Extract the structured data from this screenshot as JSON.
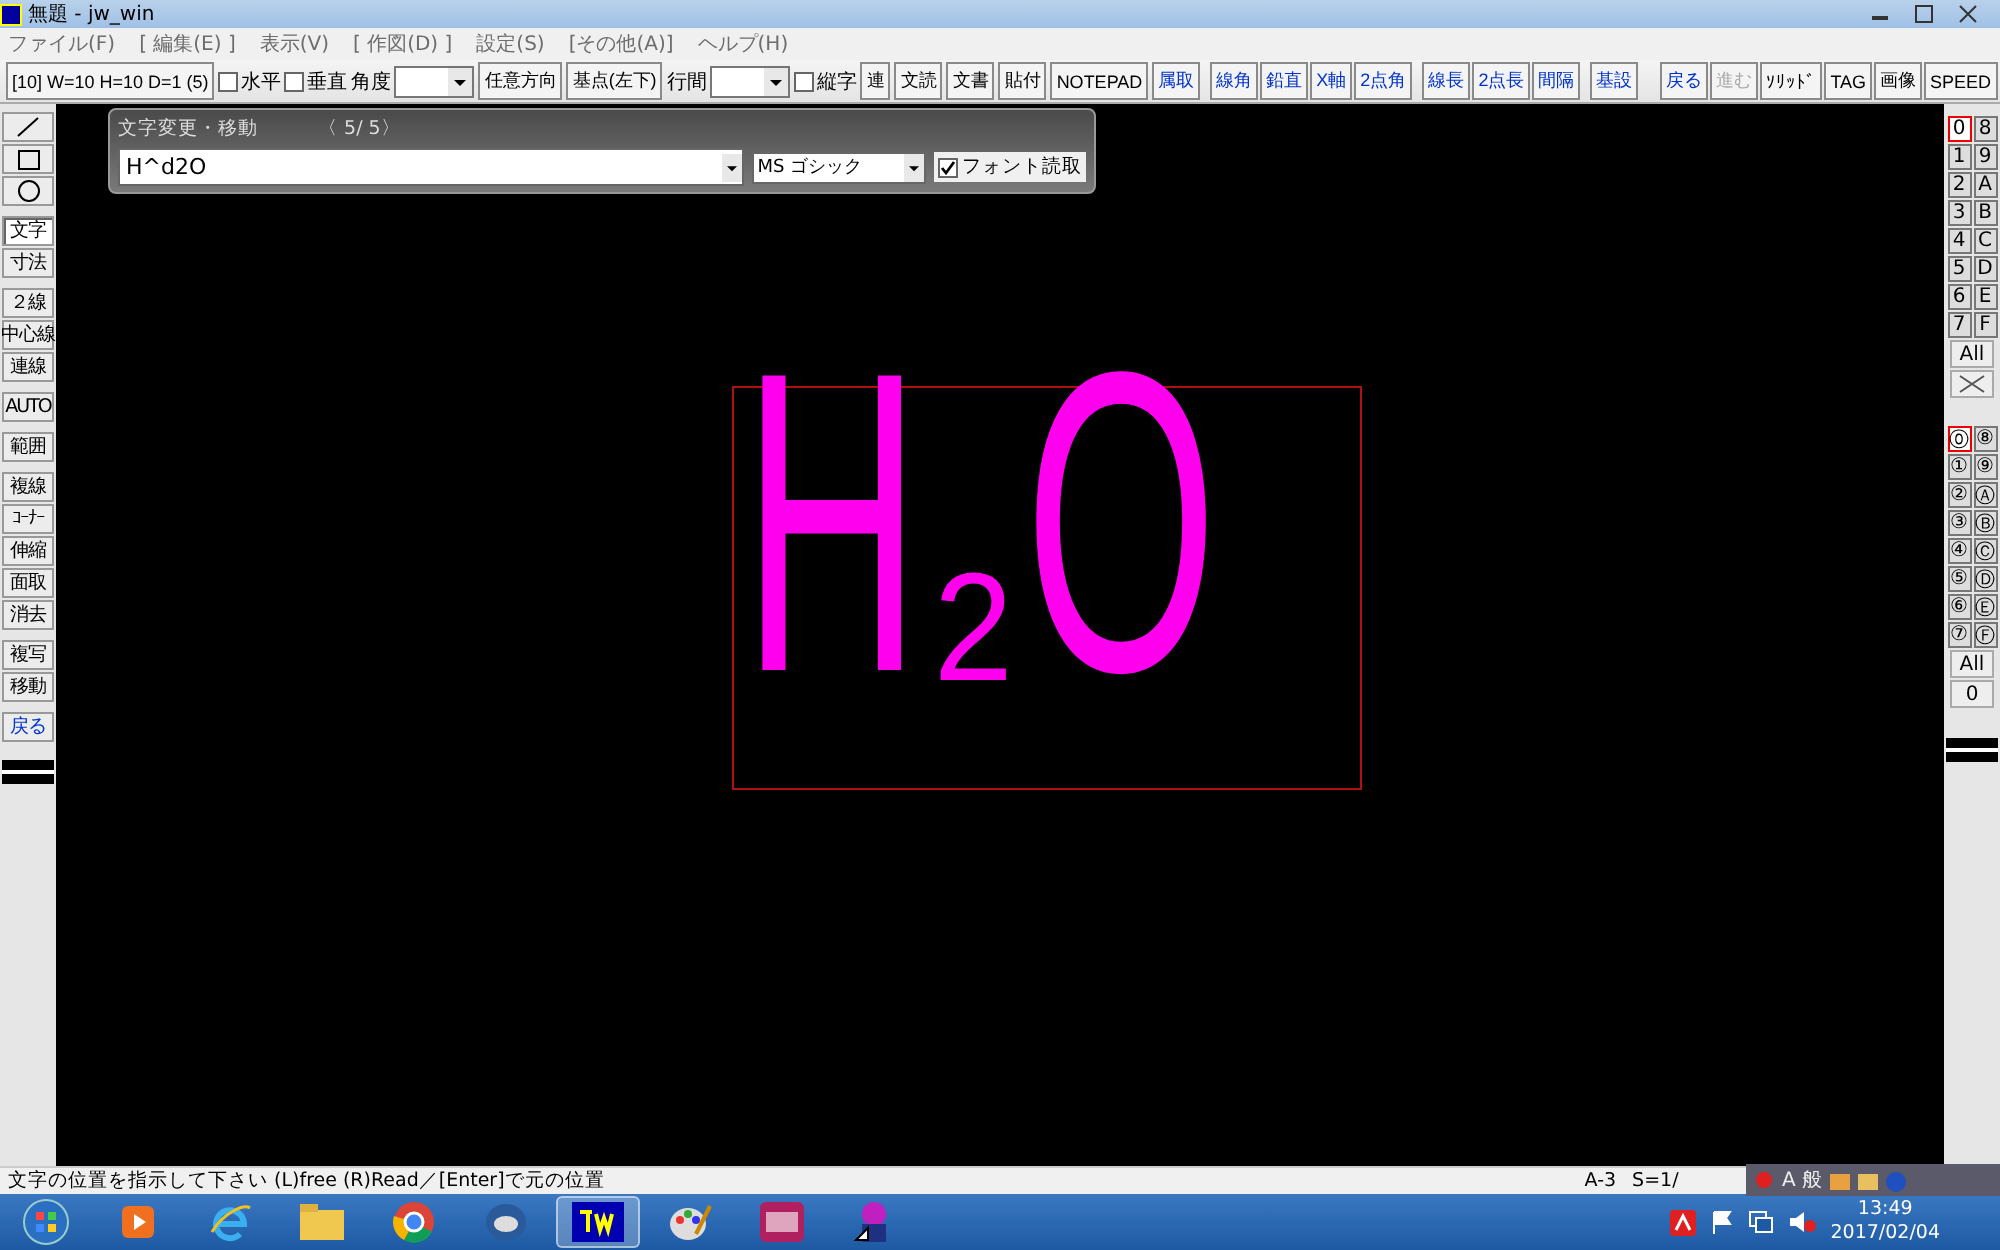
{
  "window": {
    "title": "無題 - jw_win"
  },
  "menu": [
    "ファイル(F)",
    "[ 編集(E) ]",
    "表示(V)",
    "[ 作図(D) ]",
    "設定(S)",
    "[その他(A)]",
    "ヘルプ(H)"
  ],
  "toolbar": {
    "size_button": "[10]  W=10 H=10 D=1 (5)",
    "items": [
      {
        "kind": "check",
        "label": "水平",
        "checked": false
      },
      {
        "kind": "check",
        "label": "垂直",
        "checked": false
      },
      {
        "kind": "label",
        "label": "角度"
      },
      {
        "kind": "combo"
      },
      {
        "kind": "button",
        "label": "任意方向"
      },
      {
        "kind": "button",
        "label": "基点(左下)"
      },
      {
        "kind": "label",
        "label": "行間"
      },
      {
        "kind": "combo"
      },
      {
        "kind": "check",
        "label": "縦字",
        "checked": false
      },
      {
        "kind": "button",
        "label": "連"
      },
      {
        "kind": "button",
        "label": "文読"
      },
      {
        "kind": "button",
        "label": "文書"
      },
      {
        "kind": "button",
        "label": "貼付"
      },
      {
        "kind": "button",
        "label": "NOTEPAD"
      }
    ],
    "right_groups": [
      [
        {
          "label": "属取",
          "kind": "blue"
        }
      ],
      [
        {
          "label": "線角",
          "kind": "blue"
        },
        {
          "label": "鉛直",
          "kind": "blue"
        },
        {
          "label": "X軸",
          "kind": "blue"
        },
        {
          "label": "2点角",
          "kind": "blue"
        }
      ],
      [
        {
          "label": "線長",
          "kind": "blue"
        },
        {
          "label": "2点長",
          "kind": "blue"
        },
        {
          "label": "間隔",
          "kind": "blue"
        }
      ],
      [
        {
          "label": "基設",
          "kind": "blue"
        }
      ],
      [
        {
          "label": "戻る",
          "kind": "blue"
        },
        {
          "label": "進む",
          "kind": "disabled"
        },
        {
          "label": "ｿﾘｯﾄﾞ",
          "kind": "plain"
        },
        {
          "label": "TAG",
          "kind": "plain"
        },
        {
          "label": "画像",
          "kind": "plain"
        },
        {
          "label": "SPEED",
          "kind": "plain"
        }
      ]
    ]
  },
  "left_tools": [
    [
      {
        "kind": "line-icon",
        "selected": false
      },
      {
        "kind": "rect-icon",
        "selected": false
      },
      {
        "kind": "circle-icon",
        "selected": false
      }
    ],
    [
      {
        "kind": "text",
        "label": "文字",
        "selected": true
      },
      {
        "kind": "text",
        "label": "寸法",
        "selected": false
      }
    ],
    [
      {
        "kind": "text",
        "label": "２線",
        "selected": false
      },
      {
        "kind": "text",
        "label": "中心線",
        "selected": false
      },
      {
        "kind": "text",
        "label": "連線",
        "selected": false
      }
    ],
    [
      {
        "kind": "text",
        "label": "AUTO",
        "selected": false
      }
    ],
    [
      {
        "kind": "text",
        "label": "範囲",
        "selected": false
      }
    ],
    [
      {
        "kind": "text",
        "label": "複線",
        "selected": false
      },
      {
        "kind": "text",
        "label": "ｺｰﾅｰ",
        "selected": false
      },
      {
        "kind": "text",
        "label": "伸縮",
        "selected": false
      },
      {
        "kind": "text",
        "label": "面取",
        "selected": false
      },
      {
        "kind": "text",
        "label": "消去",
        "selected": false
      }
    ],
    [
      {
        "kind": "text",
        "label": "複写",
        "selected": false
      },
      {
        "kind": "text",
        "label": "移動",
        "selected": false
      }
    ],
    [
      {
        "kind": "blue",
        "label": "戻る",
        "selected": false
      }
    ]
  ],
  "layers": {
    "rows": [
      [
        {
          "label": "0",
          "selected": true
        },
        {
          "label": "8",
          "selected": false
        }
      ],
      [
        {
          "label": "1",
          "selected": false
        },
        {
          "label": "9",
          "selected": false
        }
      ],
      [
        {
          "label": "2",
          "selected": false
        },
        {
          "label": "A",
          "selected": false
        }
      ],
      [
        {
          "label": "3",
          "selected": false
        },
        {
          "label": "B",
          "selected": false
        }
      ],
      [
        {
          "label": "4",
          "selected": false
        },
        {
          "label": "C",
          "selected": false
        }
      ],
      [
        {
          "label": "5",
          "selected": false
        },
        {
          "label": "D",
          "selected": false
        }
      ],
      [
        {
          "label": "6",
          "selected": false
        },
        {
          "label": "E",
          "selected": false
        }
      ],
      [
        {
          "label": "7",
          "selected": false
        },
        {
          "label": "F",
          "selected": false
        }
      ]
    ],
    "all": "All"
  },
  "layer_groups": {
    "rows": [
      [
        {
          "label": "⓪",
          "selected": true
        },
        {
          "label": "⑧",
          "selected": false
        }
      ],
      [
        {
          "label": "①",
          "selected": false
        },
        {
          "label": "⑨",
          "selected": false
        }
      ],
      [
        {
          "label": "②",
          "selected": false
        },
        {
          "label": "Ⓐ",
          "selected": false
        }
      ],
      [
        {
          "label": "③",
          "selected": false
        },
        {
          "label": "Ⓑ",
          "selected": false
        }
      ],
      [
        {
          "label": "④",
          "selected": false
        },
        {
          "label": "Ⓒ",
          "selected": false
        }
      ],
      [
        {
          "label": "⑤",
          "selected": false
        },
        {
          "label": "Ⓓ",
          "selected": false
        }
      ],
      [
        {
          "label": "⑥",
          "selected": false
        },
        {
          "label": "Ⓔ",
          "selected": false
        }
      ],
      [
        {
          "label": "⑦",
          "selected": false
        },
        {
          "label": "Ⓕ",
          "selected": false
        }
      ]
    ],
    "all": "All",
    "current": "0"
  },
  "dialog": {
    "title": "文字変更・移動",
    "counter": "〈  5/  5〉",
    "value": "H^d2O",
    "font": "MS ゴシック",
    "font_read": {
      "label": "フォント読取",
      "checked": true
    }
  },
  "drawing_text": "H$_{2}$O",
  "status_bar": {
    "message": "文字の位置を指示して下さい (L)free (R)Read／[Enter]で元の位置",
    "paper": "A-3",
    "scale": "S=1/"
  },
  "ime_bar": {
    "label": "A 般"
  },
  "taskbar": {
    "time": "13:49",
    "date": "2017/02/04"
  }
}
